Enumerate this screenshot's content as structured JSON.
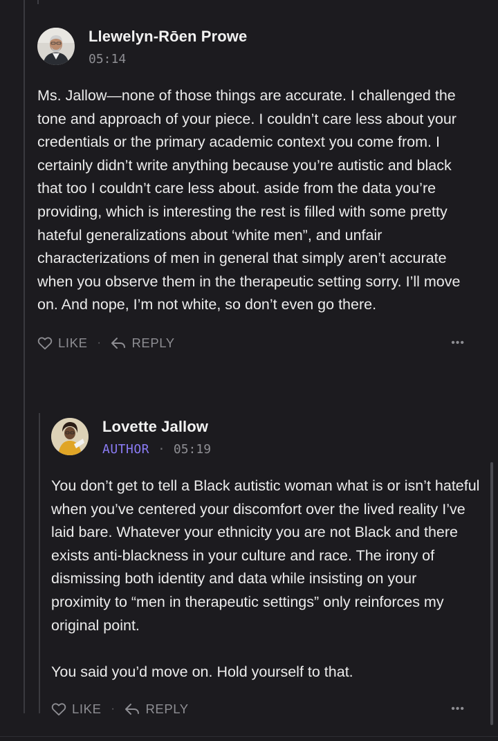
{
  "comments": [
    {
      "author": "Llewelyn-Rōen Prowe",
      "badge": "",
      "time": "05:14",
      "paragraphs": [
        "Ms. Jallow—none of those things are accurate. I challenged the tone and approach of your piece. I couldn’t care less about your credentials or the primary academic context you come from. I certainly didn’t write anything because you’re autistic and black that too I couldn’t care less about. aside from the data you’re providing, which is interesting the rest is filled with some pretty hateful generalizations about ‘white men”,  and unfair characterizations of men in general that simply aren’t accurate when you observe them in the therapeutic setting sorry. I’ll move on. And nope, I’m not white, so don’t even go there."
      ],
      "like_label": "LIKE",
      "reply_label": "REPLY",
      "more_label": "•••"
    },
    {
      "author": "Lovette Jallow",
      "badge": "AUTHOR",
      "time": "05:19",
      "paragraphs": [
        "You don’t get to tell a Black autistic woman what is or isn’t hateful when you’ve centered your discomfort over the lived reality I’ve laid bare. Whatever your ethnicity you are not Black and there exists anti-blackness in your culture and race. The irony of dismissing both identity and data while insisting on your proximity to “men in therapeutic settings” only reinforces my original point.",
        "You said you’d move on. Hold yourself to that."
      ],
      "like_label": "LIKE",
      "reply_label": "REPLY",
      "more_label": "•••"
    }
  ],
  "separators": {
    "dot": "·"
  },
  "colors": {
    "background": "#1c1b1f",
    "text": "#ececec",
    "muted": "#8e8e93",
    "author_badge": "#8b7cf6"
  },
  "icons": [
    "heart-icon",
    "reply-arrow-icon",
    "more-dots-icon"
  ]
}
